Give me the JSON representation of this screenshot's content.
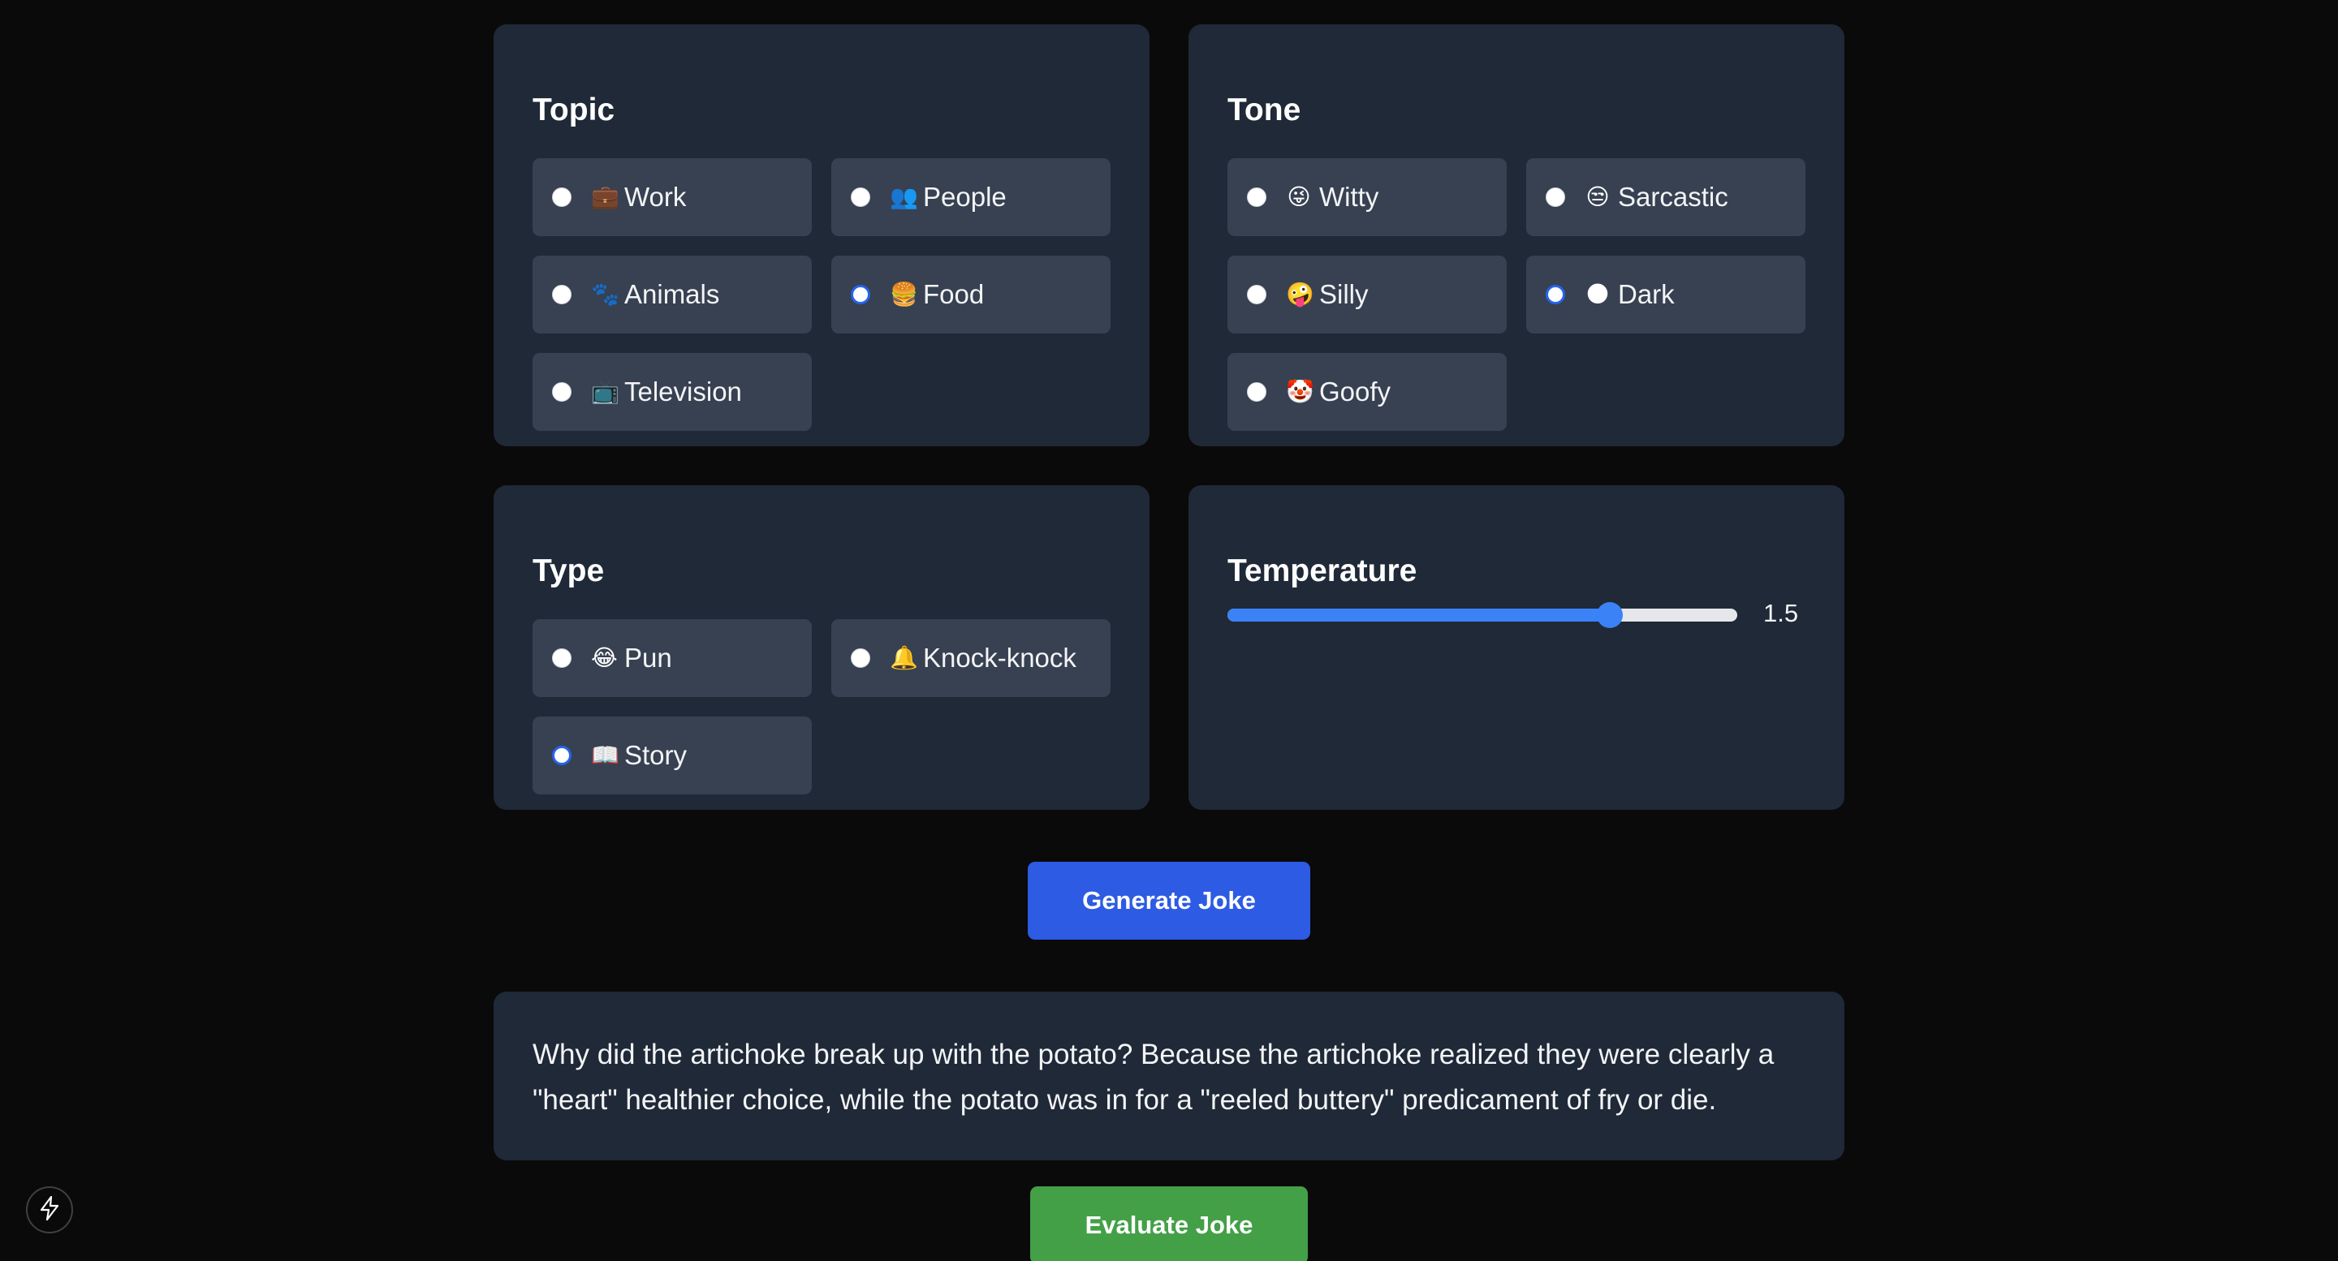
{
  "topic": {
    "title": "Topic",
    "options": [
      {
        "label": "Work",
        "icon": "briefcase-icon",
        "glyph": "💼",
        "checked": false
      },
      {
        "label": "People",
        "icon": "people-icon",
        "glyph": "👥",
        "checked": false
      },
      {
        "label": "Animals",
        "icon": "paw-icon",
        "glyph": "🐾",
        "checked": false
      },
      {
        "label": "Food",
        "icon": "burger-icon",
        "glyph": "🍔",
        "checked": true
      },
      {
        "label": "Television",
        "icon": "television-icon",
        "glyph": "📺",
        "checked": false
      }
    ]
  },
  "tone": {
    "title": "Tone",
    "options": [
      {
        "label": "Witty",
        "icon": "winking-tongue-face-icon",
        "glyph": "😜",
        "checked": false
      },
      {
        "label": "Sarcastic",
        "icon": "unamused-face-icon",
        "glyph": "😒",
        "checked": false
      },
      {
        "label": "Silly",
        "icon": "zany-face-icon",
        "glyph": "🤪",
        "checked": false
      },
      {
        "label": "Dark",
        "icon": "dark-moon-icon",
        "glyph": "🌑",
        "checked": true
      },
      {
        "label": "Goofy",
        "icon": "clown-face-icon",
        "glyph": "🤡",
        "checked": false
      }
    ]
  },
  "type": {
    "title": "Type",
    "options": [
      {
        "label": "Pun",
        "icon": "laughing-tears-icon",
        "glyph": "😂",
        "checked": false
      },
      {
        "label": "Knock-knock",
        "icon": "bell-icon",
        "glyph": "🔔",
        "checked": false
      },
      {
        "label": "Story",
        "icon": "open-book-icon",
        "glyph": "📖",
        "checked": true
      }
    ]
  },
  "temperature": {
    "title": "Temperature",
    "value": "1.5",
    "fraction": 0.75
  },
  "generate_button": {
    "label": "Generate Joke"
  },
  "joke": {
    "text": "Why did the artichoke break up with the potato? Because the artichoke realized they were clearly a \"heart\" healthier choice, while the potato was in for a \"reeled buttery\" predicament of fry or die."
  },
  "evaluate_button": {
    "label": "Evaluate Joke"
  },
  "colors": {
    "background": "#0a0a0a",
    "card": "#1f2937",
    "option": "#374151",
    "accent_blue": "#2d5be3",
    "accent_green": "#43a047",
    "slider": "#3b82f6"
  },
  "dev_tools": {
    "icon": "lightning-bolt-icon"
  }
}
